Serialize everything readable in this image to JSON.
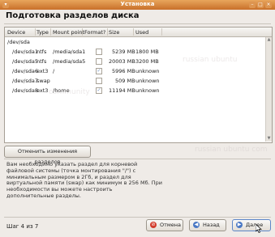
{
  "window": {
    "title": "Установка"
  },
  "header": {
    "title": "Подготовка разделов диска"
  },
  "table": {
    "columns": [
      "Device",
      "Type",
      "Mount point",
      "Format?",
      "Size",
      "Used"
    ],
    "group": "/dev/sda",
    "rows": [
      {
        "device": "/dev/sda1",
        "type": "ntfs",
        "mount": "/media/sda1",
        "format": false,
        "size": "5239 MB",
        "used": "1800 MB"
      },
      {
        "device": "/dev/sda5",
        "type": "ntfs",
        "mount": "/media/sda5",
        "format": false,
        "size": "20003 MB",
        "used": "3200 MB"
      },
      {
        "device": "/dev/sda6",
        "type": "ext3",
        "mount": "/",
        "format": true,
        "size": "5996 MB",
        "used": "unknown"
      },
      {
        "device": "/dev/sda7",
        "type": "swap",
        "mount": "",
        "format": false,
        "size": "509 MB",
        "used": "unknown"
      },
      {
        "device": "/dev/sda8",
        "type": "ext3",
        "mount": "/home",
        "format": true,
        "size": "11194 MB",
        "used": "unknown"
      }
    ]
  },
  "undo_button": {
    "label": "Отменить изменения разделов"
  },
  "info": {
    "lines": [
      "Вам необходимо указать раздел для корневой",
      "файловой системы (точка монтирования \"/\") с",
      "минимальным размером в 2Гб, и раздел для",
      "виртуальной памяти (swap) как минимум в 256 Мб. При",
      "необходимости вы можете настроить",
      "дополнительные разделы."
    ]
  },
  "footer": {
    "step": "Шаг 4 из 7",
    "cancel": "Отмена",
    "back": "Назад",
    "forward": "Далее"
  },
  "watermarks": [
    "russian ubuntu",
    "community",
    "russian ubuntu com"
  ],
  "colors": {
    "title_bar": "#d6843c",
    "check_accent": "#6d8fbf"
  }
}
